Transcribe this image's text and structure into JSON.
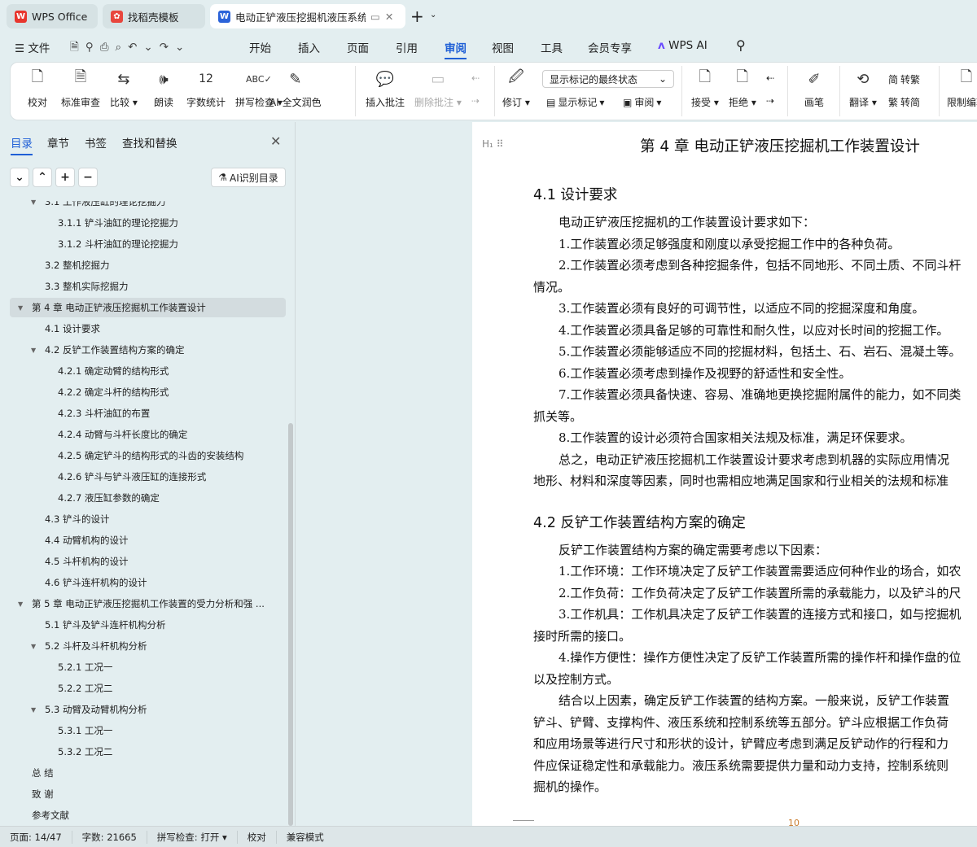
{
  "tabs": [
    {
      "label": "WPS Office",
      "icon": "wps-logo-icon"
    },
    {
      "label": "找稻壳模板",
      "icon": "docer-logo-icon"
    },
    {
      "label": "电动正铲液压挖掘机液压系统",
      "icon": "writer-logo-icon"
    }
  ],
  "menu": {
    "file": "文件",
    "items": [
      "开始",
      "插入",
      "页面",
      "引用",
      "审阅",
      "视图",
      "工具",
      "会员专享"
    ],
    "active": "审阅",
    "ai": "WPS AI"
  },
  "ribbon": {
    "buttons": [
      "校对",
      "标准审查",
      "比较",
      "朗读",
      "字数统计",
      "拼写检查",
      "AI 全文润色",
      "插入批注",
      "删除批注",
      "修订",
      "接受",
      "拒绝",
      "画笔",
      "翻译",
      "限制编辑"
    ],
    "markup_select": "显示标记的最终状态",
    "show_markup": "显示标记",
    "review_pane": "审阅",
    "to_traditional": "转繁",
    "to_simplified": "转简"
  },
  "sidebar": {
    "tabs": [
      "目录",
      "章节",
      "书签",
      "查找和替换"
    ],
    "ai_toc": "AI识别目录",
    "toc": [
      {
        "t": "3.1  工作液压缸的理论挖掘力",
        "l": 2,
        "exp": true
      },
      {
        "t": "3.1.1 铲斗油缸的理论挖掘力",
        "l": 3
      },
      {
        "t": "3.1.2  斗杆油缸的理论挖掘力",
        "l": 3
      },
      {
        "t": "3.2  整机挖掘力",
        "l": 2
      },
      {
        "t": "3.3  整机实际挖掘力",
        "l": 2
      },
      {
        "t": "第 4 章  电动正铲液压挖掘机工作装置设计",
        "l": 1,
        "exp": true,
        "sel": true
      },
      {
        "t": "4.1 设计要求",
        "l": 2
      },
      {
        "t": "4.2 反铲工作装置结构方案的确定",
        "l": 2,
        "exp": true
      },
      {
        "t": "4.2.1 确定动臂的结构形式",
        "l": 3
      },
      {
        "t": "4.2.2 确定斗杆的结构形式",
        "l": 3
      },
      {
        "t": "4.2.3 斗杆油缸的布置",
        "l": 3
      },
      {
        "t": "4.2.4 动臂与斗杆长度比的确定",
        "l": 3
      },
      {
        "t": "4.2.5 确定铲斗的结构形式的斗齿的安装结构",
        "l": 3
      },
      {
        "t": "4.2.6 铲斗与铲斗液压缸的连接形式",
        "l": 3
      },
      {
        "t": "4.2.7 液压缸参数的确定",
        "l": 3
      },
      {
        "t": "4.3  铲斗的设计",
        "l": 2
      },
      {
        "t": "4.4 动臂机构的设计",
        "l": 2
      },
      {
        "t": "4.5 斗杆机构的设计",
        "l": 2
      },
      {
        "t": "4.6  铲斗连杆机构的设计",
        "l": 2
      },
      {
        "t": "第 5 章  电动正铲液压挖掘机工作装置的受力分析和强 ...",
        "l": 1,
        "exp": true
      },
      {
        "t": "5.1 铲斗及铲斗连杆机构分析",
        "l": 2
      },
      {
        "t": "5.2 斗杆及斗杆机构分析",
        "l": 2,
        "exp": true
      },
      {
        "t": "5.2.1 工况一",
        "l": 3
      },
      {
        "t": "5.2.2 工况二",
        "l": 3
      },
      {
        "t": "5.3 动臂及动臂机构分析",
        "l": 2,
        "exp": true
      },
      {
        "t": "5.3.1 工况一",
        "l": 3
      },
      {
        "t": "5.3.2 工况二",
        "l": 3
      },
      {
        "t": "总   结",
        "l": 1
      },
      {
        "t": "致   谢",
        "l": 1
      },
      {
        "t": "参考文献",
        "l": 1
      }
    ]
  },
  "document": {
    "chapter_title": "第 4 章  电动正铲液压挖掘机工作装置设计",
    "lines": [
      {
        "t": "4.1 设计要求",
        "h": true
      },
      {
        "t": "电动正铲液压挖掘机的工作装置设计要求如下：",
        "i": true
      },
      {
        "t": "1.工作装置必须足够强度和刚度以承受挖掘工作中的各种负荷。",
        "i": true
      },
      {
        "t": "2.工作装置必须考虑到各种挖掘条件，包括不同地形、不同土质、不同斗杆",
        "i": true
      },
      {
        "t": "情况。"
      },
      {
        "t": "3.工作装置必须有良好的可调节性，以适应不同的挖掘深度和角度。",
        "i": true
      },
      {
        "t": "4.工作装置必须具备足够的可靠性和耐久性，以应对长时间的挖掘工作。",
        "i": true
      },
      {
        "t": "5.工作装置必须能够适应不同的挖掘材料，包括土、石、岩石、混凝土等。",
        "i": true
      },
      {
        "t": "6.工作装置必须考虑到操作及视野的舒适性和安全性。",
        "i": true
      },
      {
        "t": "7.工作装置必须具备快速、容易、准确地更换挖掘附属件的能力，如不同类",
        "i": true
      },
      {
        "t": "抓关等。"
      },
      {
        "t": "8.工作装置的设计必须符合国家相关法规及标准，满足环保要求。",
        "i": true
      },
      {
        "t": "总之，电动正铲液压挖掘机工作装置设计要求考虑到机器的实际应用情况",
        "i": true
      },
      {
        "t": "地形、材料和深度等因素，同时也需相应地满足国家和行业相关的法规和标准"
      },
      {
        "t": "4.2 反铲工作装置结构方案的确定",
        "h": true
      },
      {
        "t": "反铲工作装置结构方案的确定需要考虑以下因素：",
        "i": true
      },
      {
        "t": "1.工作环境：工作环境决定了反铲工作装置需要适应何种作业的场合，如农",
        "i": true
      },
      {
        "t": "2.工作负荷：工作负荷决定了反铲工作装置所需的承载能力，以及铲斗的尺",
        "i": true
      },
      {
        "t": "3.工作机具：工作机具决定了反铲工作装置的连接方式和接口，如与挖掘机",
        "i": true
      },
      {
        "t": "接时所需的接口。"
      },
      {
        "t": "4.操作方便性：操作方便性决定了反铲工作装置所需的操作杆和操作盘的位",
        "i": true
      },
      {
        "t": "以及控制方式。"
      },
      {
        "t": "结合以上因素，确定反铲工作装置的结构方案。一般来说，反铲工作装置",
        "i": true
      },
      {
        "t": "铲斗、铲臂、支撑构件、液压系统和控制系统等五部分。铲斗应根据工作负荷"
      },
      {
        "t": "和应用场景等进行尺寸和形状的设计，铲臂应考虑到满足反铲动作的行程和力"
      },
      {
        "t": "件应保证稳定性和承载能力。液压系统需要提供力量和动力支持，控制系统则"
      },
      {
        "t": "掘机的操作。"
      }
    ],
    "page_number": "10"
  },
  "status": {
    "page": "页面: 14/47",
    "words": "字数: 21665",
    "spell": "拼写检查: 打开",
    "proof": "校对",
    "compat": "兼容模式"
  },
  "colors": {
    "accent": "#1f5fd6",
    "background": "#e3eef0"
  }
}
